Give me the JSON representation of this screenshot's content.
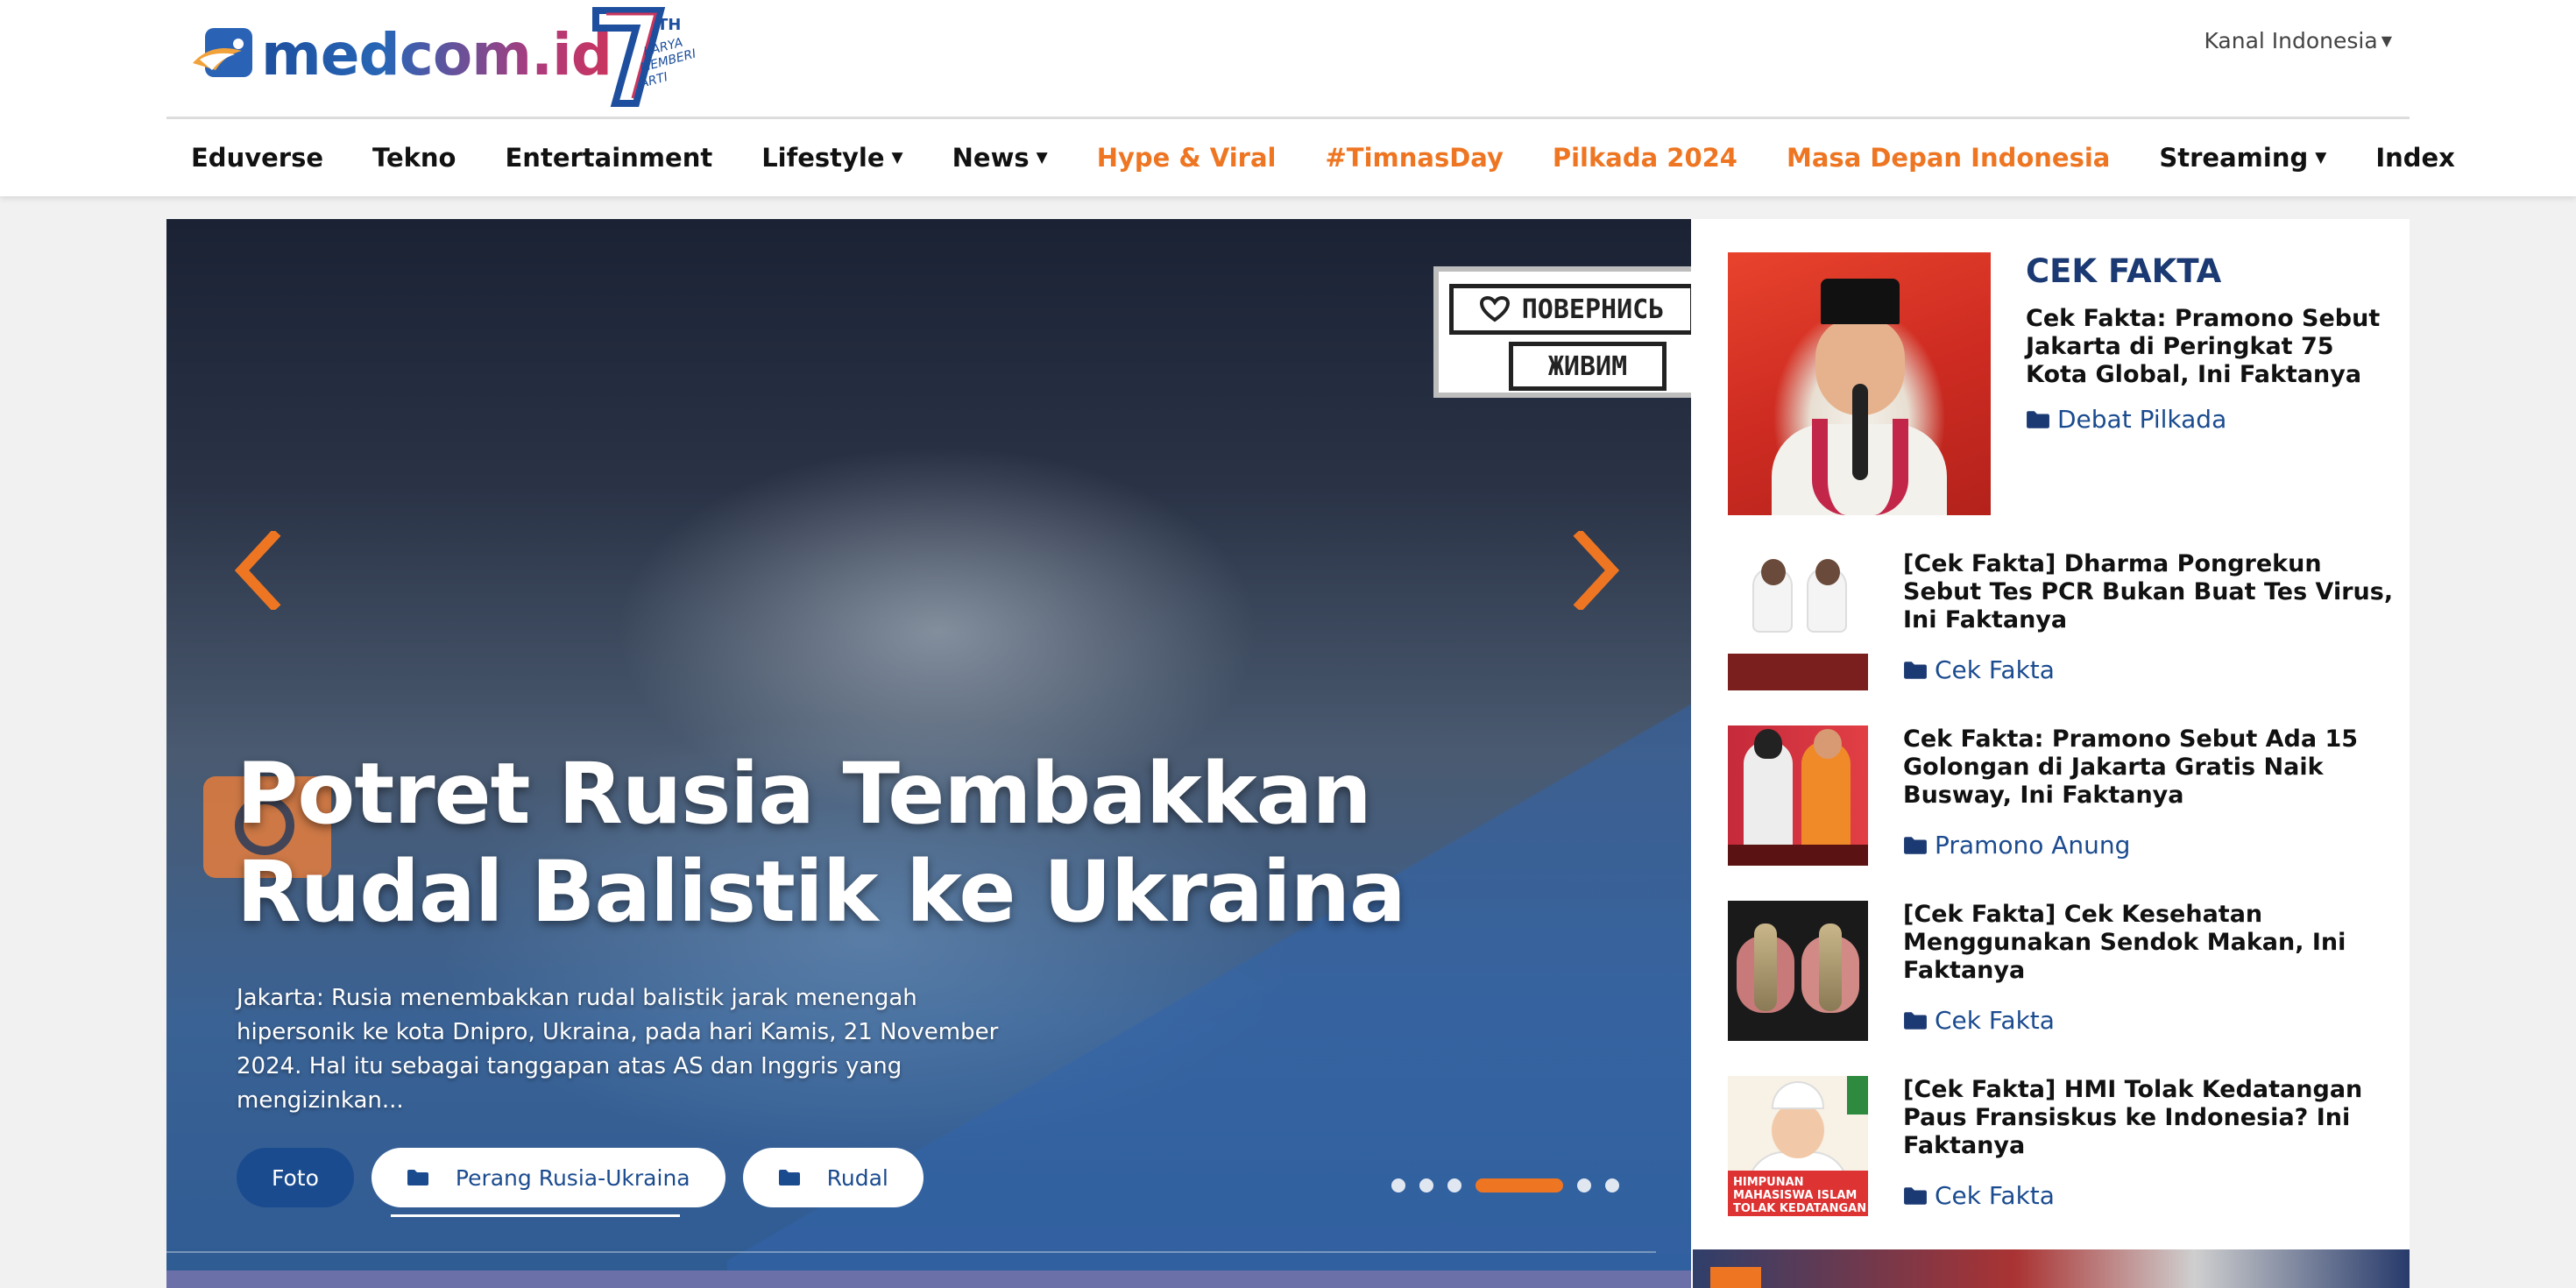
{
  "header": {
    "logo_text": "medcom.id",
    "logo_badge": "7TH",
    "logo_badge_sub": "KARYA MEMBERI ARTI",
    "kanal": "Kanal Indonesia"
  },
  "nav": {
    "items": [
      {
        "label": "Eduverse"
      },
      {
        "label": "Tekno"
      },
      {
        "label": "Entertainment"
      },
      {
        "label": "Lifestyle"
      },
      {
        "label": "News"
      },
      {
        "label": "Hype & Viral"
      },
      {
        "label": "#TimnasDay"
      },
      {
        "label": "Pilkada 2024"
      },
      {
        "label": "Masa Depan Indonesia"
      },
      {
        "label": "Streaming"
      },
      {
        "label": "Index"
      }
    ],
    "highlight_color": "#ee7623"
  },
  "hero": {
    "title": "Potret Rusia Tembakkan Rudal Balistik ke Ukraina",
    "summary": "Jakarta: Rusia menembakkan rudal balistik jarak menengah hipersonik ke kota Dnipro, Ukraina, pada hari Kamis, 21 November 2024. Hal itu sebagai tanggapan atas AS dan Inggris yang mengizinkan...",
    "sign_line1": "ПОВЕРНИСЬ",
    "sign_line2": "ЖИВИМ",
    "tags": {
      "type": "Foto",
      "tag1": "Perang Rusia-Ukraina",
      "tag2": "Rudal"
    },
    "slides_total": 6,
    "active_slide": 4
  },
  "sidebar": {
    "section": "CEK FAKTA",
    "featured": {
      "title": "Cek Fakta: Pramono Sebut Jakarta di Peringkat 75 Kota Global, Ini Faktanya",
      "category": "Debat Pilkada"
    },
    "items": [
      {
        "title": "[Cek Fakta] Dharma Pongrekun Sebut Tes PCR Bukan Buat Tes Virus, Ini Faktanya",
        "category": "Cek Fakta"
      },
      {
        "title": "Cek Fakta: Pramono Sebut Ada 15 Golongan di Jakarta Gratis Naik Busway, Ini Faktanya",
        "category": "Pramono Anung"
      },
      {
        "title": "[Cek Fakta] Cek Kesehatan Menggunakan Sendok Makan, Ini Faktanya",
        "category": "Cek Fakta"
      },
      {
        "title": "[Cek Fakta] HMI Tolak Kedatangan Paus Fransiskus ke Indonesia? Ini Faktanya",
        "category": "Cek Fakta"
      }
    ],
    "thumb5_text": "HIMPUNAN MAHASISWA ISLAM TOLAK KEDATANGAN"
  }
}
